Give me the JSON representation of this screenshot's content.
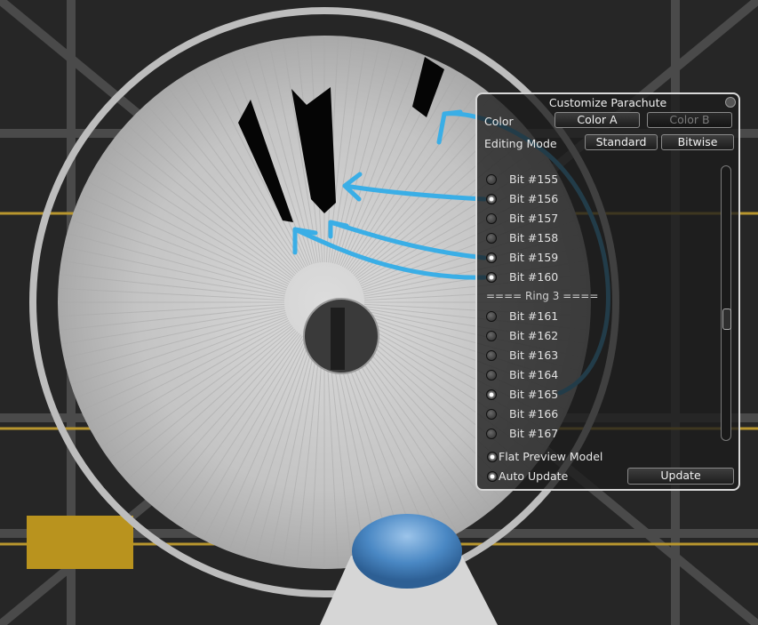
{
  "panel": {
    "title": "Customize Parachute",
    "color_label": "Color",
    "color_a": "Color A",
    "color_b": "Color B",
    "editing_mode_label": "Editing Mode",
    "mode_standard": "Standard",
    "mode_bitwise": "Bitwise",
    "bits_group_1": [
      {
        "label": "Bit #155",
        "checked": false
      },
      {
        "label": "Bit #156",
        "checked": true
      },
      {
        "label": "Bit #157",
        "checked": false
      },
      {
        "label": "Bit #158",
        "checked": false
      },
      {
        "label": "Bit #159",
        "checked": true
      },
      {
        "label": "Bit #160",
        "checked": true
      }
    ],
    "ring_header": "==== Ring 3 ====",
    "bits_group_2": [
      {
        "label": "Bit #161",
        "checked": false
      },
      {
        "label": "Bit #162",
        "checked": false
      },
      {
        "label": "Bit #163",
        "checked": false
      },
      {
        "label": "Bit #164",
        "checked": false
      },
      {
        "label": "Bit #165",
        "checked": true
      },
      {
        "label": "Bit #166",
        "checked": false
      },
      {
        "label": "Bit #167",
        "checked": false
      }
    ],
    "flat_preview_label": "Flat Preview Model",
    "auto_update_label": "Auto Update",
    "update_button": "Update"
  },
  "colors": {
    "accent_arrow": "#3aaee6",
    "panel_border": "#d8d8d8",
    "canopy": "#c8c8c8",
    "nose": "#5a92c8"
  }
}
